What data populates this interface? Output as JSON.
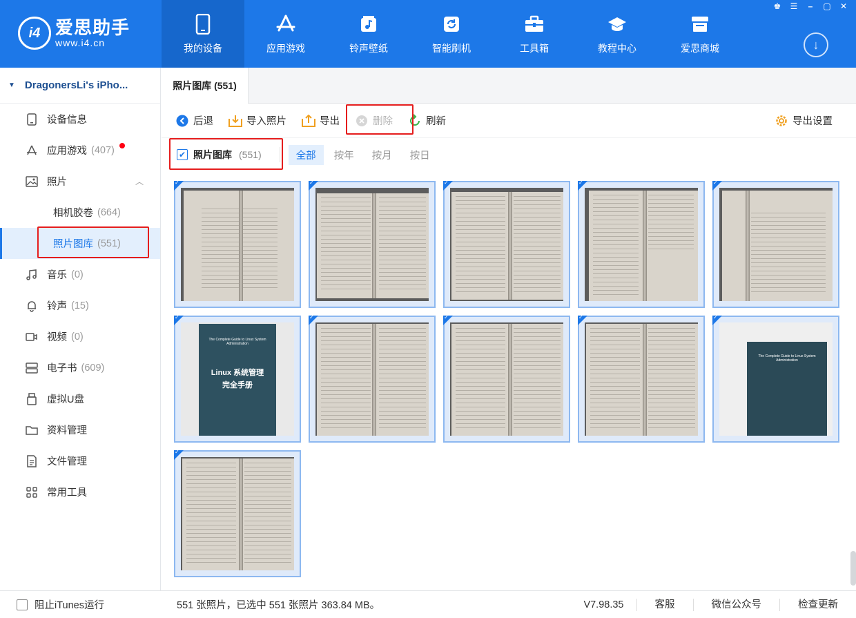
{
  "app": {
    "logo_name": "爱思助手",
    "logo_url": "www.i4.cn",
    "logo_badge": "i4"
  },
  "nav": [
    {
      "label": "我的设备",
      "icon": "phone-icon",
      "active": true
    },
    {
      "label": "应用游戏",
      "icon": "app-store-icon"
    },
    {
      "label": "铃声壁纸",
      "icon": "music-wallpaper-icon"
    },
    {
      "label": "智能刷机",
      "icon": "flash-icon"
    },
    {
      "label": "工具箱",
      "icon": "toolbox-icon"
    },
    {
      "label": "教程中心",
      "icon": "graduation-cap-icon"
    },
    {
      "label": "爱思商城",
      "icon": "shop-icon"
    }
  ],
  "sidebar": {
    "device_name": "DragonersLi's iPho...",
    "items": [
      {
        "label": "设备信息",
        "count": "",
        "icon": "device-info-icon"
      },
      {
        "label": "应用游戏",
        "count": "(407)",
        "icon": "apps-icon"
      },
      {
        "label": "照片",
        "count": "",
        "icon": "photo-icon"
      },
      {
        "label": "相机胶卷",
        "count": "(664)",
        "icon": ""
      },
      {
        "label": "照片图库",
        "count": "(551)",
        "icon": ""
      },
      {
        "label": "音乐",
        "count": "(0)",
        "icon": "music-note-icon"
      },
      {
        "label": "铃声",
        "count": "(15)",
        "icon": "bell-icon"
      },
      {
        "label": "视频",
        "count": "(0)",
        "icon": "video-icon"
      },
      {
        "label": "电子书",
        "count": "(609)",
        "icon": "ebook-icon"
      },
      {
        "label": "虚拟U盘",
        "count": "",
        "icon": "usb-drive-icon"
      },
      {
        "label": "资料管理",
        "count": "",
        "icon": "folder-icon"
      },
      {
        "label": "文件管理",
        "count": "",
        "icon": "file-icon"
      },
      {
        "label": "常用工具",
        "count": "",
        "icon": "grid-icon"
      }
    ]
  },
  "main": {
    "tab_label": "照片图库 (551)",
    "toolbar": {
      "back": "后退",
      "import": "导入照片",
      "export": "导出",
      "delete": "删除",
      "refresh": "刷新",
      "export_settings": "导出设置"
    },
    "filter": {
      "album_name": "照片图库",
      "album_count": "(551)",
      "tabs": [
        "全部",
        "按年",
        "按月",
        "按日"
      ],
      "active_tab": "全部"
    },
    "book_cover": {
      "en_title": "The Complete Guide to Linux System Administration",
      "cn_title_1": "Linux 系统管理",
      "cn_title_2": "完全手册"
    }
  },
  "status": {
    "itunes_label": "阻止iTunes运行",
    "info": "551 张照片，已选中 551 张照片 363.84 MB。",
    "version": "V7.98.35",
    "service": "客服",
    "wechat": "微信公众号",
    "update": "检查更新"
  }
}
